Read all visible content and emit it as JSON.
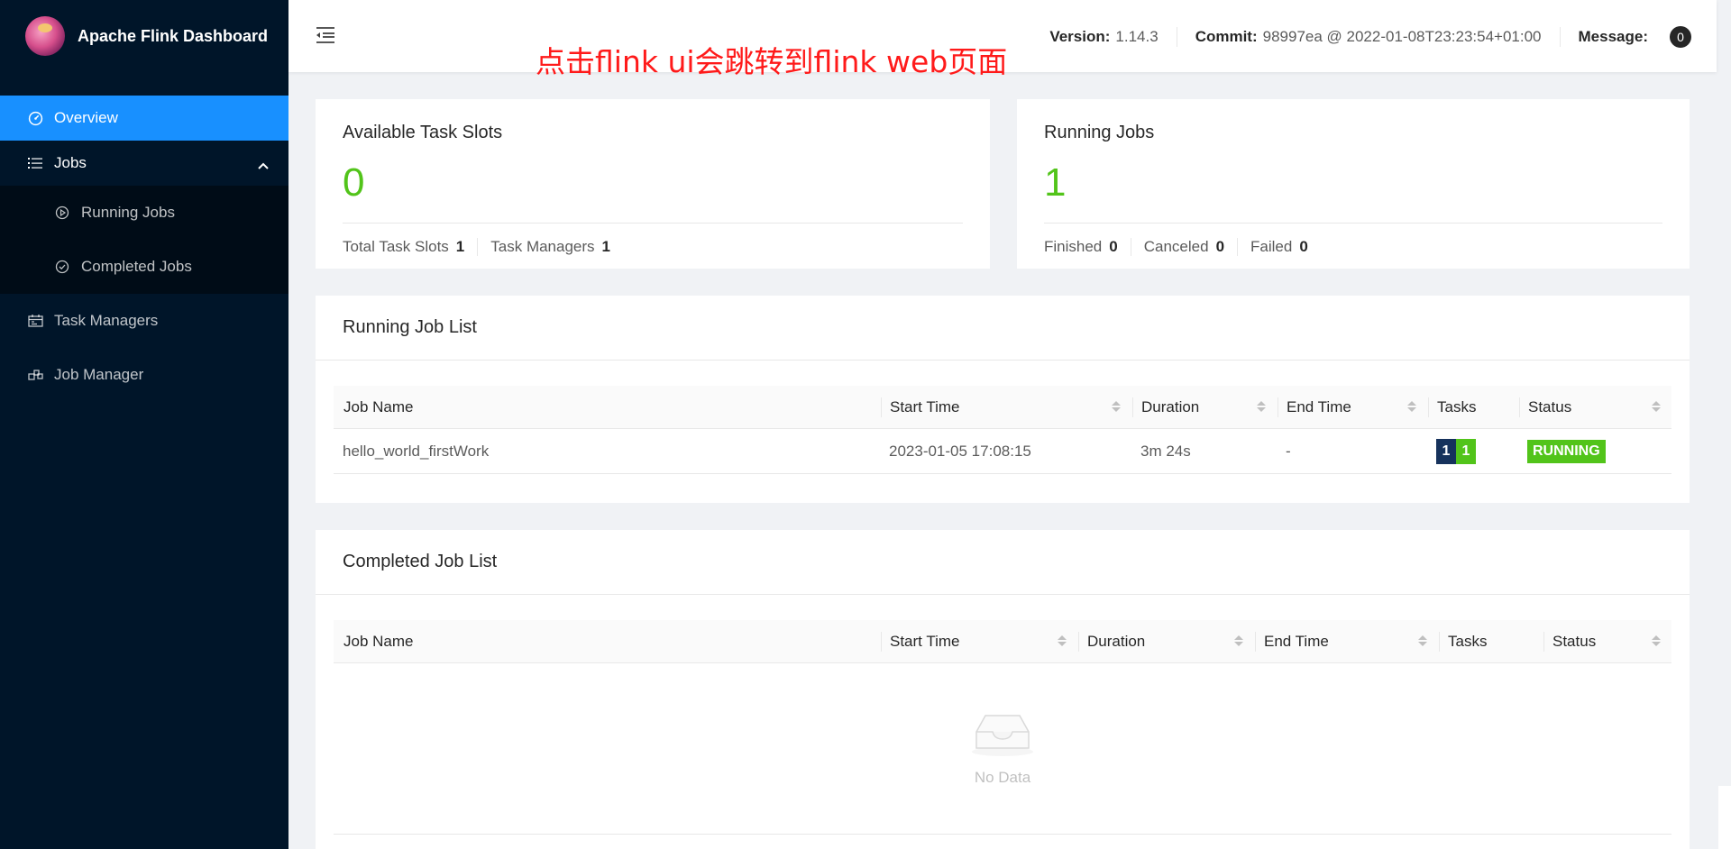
{
  "brand": {
    "title": "Apache Flink Dashboard"
  },
  "sidebar": {
    "items": [
      {
        "label": "Overview",
        "icon": "dashboard-icon"
      },
      {
        "label": "Jobs",
        "icon": "list-icon"
      },
      {
        "label": "Running Jobs",
        "icon": "play-circle-icon"
      },
      {
        "label": "Completed Jobs",
        "icon": "check-circle-icon"
      },
      {
        "label": "Task Managers",
        "icon": "schedule-icon"
      },
      {
        "label": "Job Manager",
        "icon": "cluster-icon"
      }
    ]
  },
  "header": {
    "annotation": "点击flink ui会跳转到flink web页面",
    "version_key": "Version:",
    "version_val": "1.14.3",
    "commit_key": "Commit:",
    "commit_val": "98997ea @ 2022-01-08T23:23:54+01:00",
    "message_key": "Message:",
    "message_count": "0"
  },
  "slots_card": {
    "title": "Available Task Slots",
    "value": "0",
    "total_label": "Total Task Slots",
    "total_val": "1",
    "tm_label": "Task Managers",
    "tm_val": "1"
  },
  "jobs_card": {
    "title": "Running Jobs",
    "value": "1",
    "finished_label": "Finished",
    "finished_val": "0",
    "canceled_label": "Canceled",
    "canceled_val": "0",
    "failed_label": "Failed",
    "failed_val": "0"
  },
  "running_list": {
    "title": "Running Job List",
    "columns": [
      "Job Name",
      "Start Time",
      "Duration",
      "End Time",
      "Tasks",
      "Status"
    ],
    "rows": [
      {
        "name": "hello_world_firstWork",
        "start": "2023-01-05 17:08:15",
        "duration": "3m 24s",
        "end": "-",
        "tasks_total": "1",
        "tasks_running": "1",
        "status": "RUNNING"
      }
    ]
  },
  "completed_list": {
    "title": "Completed Job List",
    "columns": [
      "Job Name",
      "Start Time",
      "Duration",
      "End Time",
      "Tasks",
      "Status"
    ],
    "empty_text": "No Data"
  },
  "colors": {
    "sidebar_bg": "#001529",
    "active": "#1890ff",
    "success": "#52c41a",
    "annotation": "#ff1a1a"
  }
}
